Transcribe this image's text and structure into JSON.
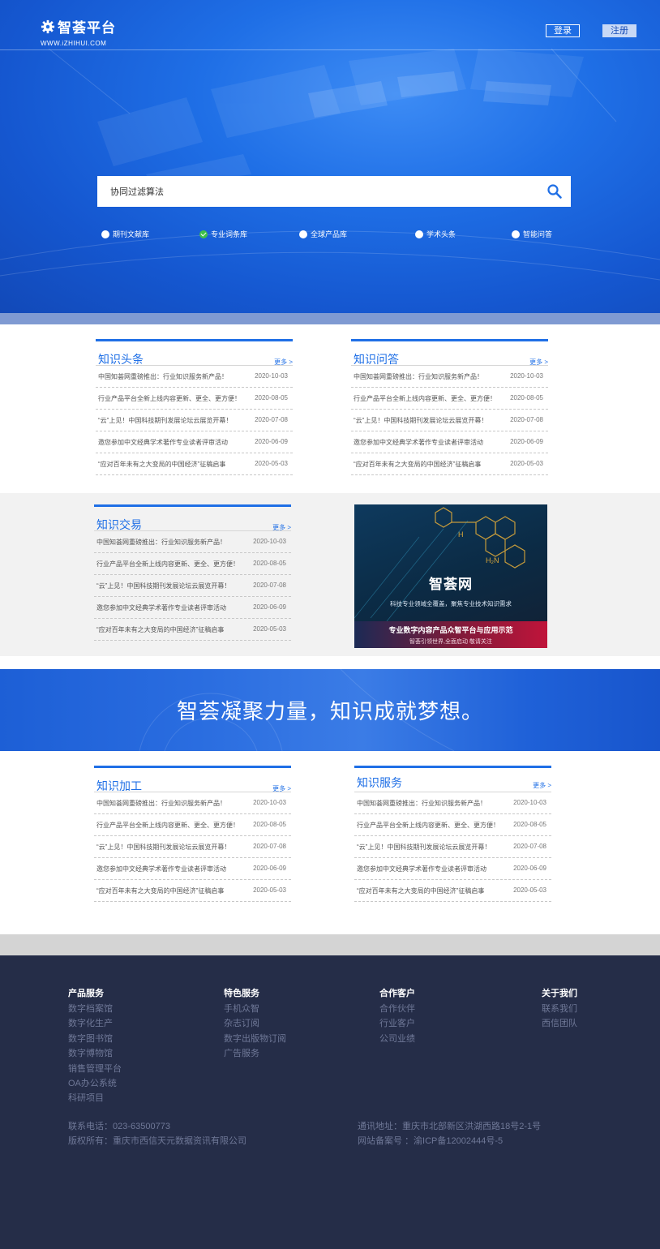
{
  "header": {
    "logo_title": "智荟平台",
    "logo_url": "WWW.iZHIHUI.COM",
    "login_label": "登录",
    "register_label": "注册"
  },
  "search": {
    "value": "协同过滤算法",
    "icon": "search-icon"
  },
  "search_scopes": [
    {
      "label": "期刊文献库",
      "checked": false
    },
    {
      "label": "专业词条库",
      "checked": true
    },
    {
      "label": "全球产品库",
      "checked": false
    },
    {
      "label": "学术头条",
      "checked": false
    },
    {
      "label": "智能问答",
      "checked": false
    }
  ],
  "sections": {
    "headlines": {
      "title": "知识头条",
      "more": "更多 >",
      "rows": [
        {
          "text": "中国知荟网重磅推出：行业知识服务新产品！",
          "date": "2020-10-03"
        },
        {
          "text": "行业产品平台全新上线内容更新、更全、更方便！",
          "date": "2020-08-05"
        },
        {
          "text": "“云”上见！中国科技期刊发展论坛云展览开幕！",
          "date": "2020-07-08"
        },
        {
          "text": "邀您参加中文经典学术著作专业读者评审活动",
          "date": "2020-06-09"
        },
        {
          "text": "“应对百年未有之大变局的中国经济”征稿启事",
          "date": "2020-05-03"
        }
      ]
    },
    "qa": {
      "title": "知识问答",
      "more": "更多 >",
      "rows": [
        {
          "text": "中国知荟网重磅推出：行业知识服务新产品！",
          "date": "2020-10-03"
        },
        {
          "text": "行业产品平台全新上线内容更新、更全、更方便！",
          "date": "2020-08-05"
        },
        {
          "text": "“云”上见！中国科技期刊发展论坛云展览开幕！",
          "date": "2020-07-08"
        },
        {
          "text": "邀您参加中文经典学术著作专业读者评审活动",
          "date": "2020-06-09"
        },
        {
          "text": "“应对百年未有之大变局的中国经济”征稿启事",
          "date": "2020-05-03"
        }
      ]
    },
    "trade": {
      "title": "知识交易",
      "more": "更多 >",
      "rows": [
        {
          "text": "中国知荟网重磅推出：行业知识服务新产品！",
          "date": "2020-10-03"
        },
        {
          "text": "行业产品平台全新上线内容更新、更全、更方便！",
          "date": "2020-08-05"
        },
        {
          "text": "“云”上见！中国科技期刊发展论坛云展览开幕！",
          "date": "2020-07-08"
        },
        {
          "text": "邀您参加中文经典学术著作专业读者评审活动",
          "date": "2020-06-09"
        },
        {
          "text": "“应对百年未有之大变局的中国经济”征稿启事",
          "date": "2020-05-03"
        }
      ]
    },
    "process": {
      "title": "知识加工",
      "more": "更多 >",
      "rows": [
        {
          "text": "中国知荟网重磅推出：行业知识服务新产品！",
          "date": "2020-10-03"
        },
        {
          "text": "行业产品平台全新上线内容更新、更全、更方便！",
          "date": "2020-08-05"
        },
        {
          "text": "“云”上见！中国科技期刊发展论坛云展览开幕！",
          "date": "2020-07-08"
        },
        {
          "text": "邀您参加中文经典学术著作专业读者评审活动",
          "date": "2020-06-09"
        },
        {
          "text": "“应对百年未有之大变局的中国经济”征稿启事",
          "date": "2020-05-03"
        }
      ]
    },
    "service": {
      "title": "知识服务",
      "more": "更多 >",
      "rows": [
        {
          "text": "中国知荟网重磅推出：行业知识服务新产品！",
          "date": "2020-10-03"
        },
        {
          "text": "行业产品平台全新上线内容更新、更全、更方便！",
          "date": "2020-08-05"
        },
        {
          "text": "“云”上见！中国科技期刊发展论坛云展览开幕！",
          "date": "2020-07-08"
        },
        {
          "text": "邀您参加中文经典学术著作专业读者评审活动",
          "date": "2020-06-09"
        },
        {
          "text": "“应对百年未有之大变局的中国经济”征稿启事",
          "date": "2020-05-03"
        }
      ]
    }
  },
  "promo": {
    "title": "智荟网",
    "subtitle": "科技专业领域全覆盖，聚焦专业技术知识需求",
    "banner_title": "专业数字内容产品众智平台与应用示范",
    "banner_sub": "智荟引领世界,全面启动  敬请关注",
    "formula_label": "H₂N"
  },
  "slogan": "智荟凝聚力量，知识成就梦想。",
  "footer": {
    "columns": [
      {
        "title": "产品服务",
        "links": [
          "数字档案馆",
          "数字化生产",
          "数字图书馆",
          "数字博物馆",
          "销售管理平台",
          "OA办公系统",
          "科研项目"
        ]
      },
      {
        "title": "特色服务",
        "links": [
          "手机众智",
          "杂志订阅",
          "数字出版物订阅",
          "广告服务"
        ]
      },
      {
        "title": "合作客户",
        "links": [
          "合作伙伴",
          "行业客户",
          "公司业绩"
        ]
      },
      {
        "title": "关于我们",
        "links": [
          "联系我们",
          "西信团队"
        ]
      }
    ],
    "phone": "联系电话：023-63500773",
    "copyright": "版权所有：重庆市西信天元数据资讯有限公司",
    "address": "通讯地址：重庆市北部新区洪湖西路18号2-1号",
    "icp": "网站备案号 ：渝ICP备12002444号-5"
  },
  "colors": {
    "accent": "#1f6fe6",
    "footer_bg": "#252d48",
    "footer_link": "#6f7897",
    "checked": "#3ec04a"
  }
}
